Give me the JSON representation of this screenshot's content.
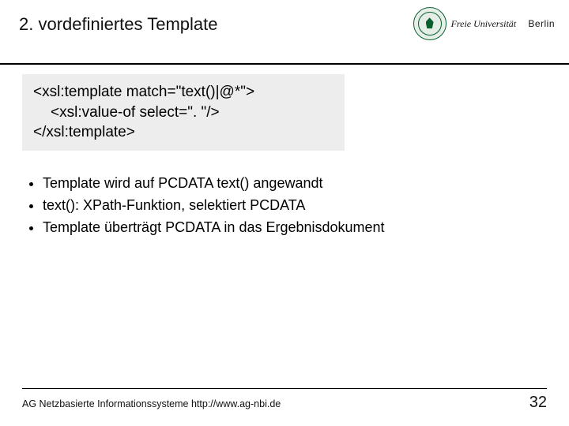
{
  "header": {
    "title": "2. vordefiniertes Template",
    "university": {
      "line1": "Freie Universität",
      "line2": "Berlin"
    }
  },
  "code": {
    "line1": "<xsl:template match=\"text()|@*\">",
    "line2": "<xsl:value-of select=\". \"/>",
    "line3": "</xsl:template>"
  },
  "bullets": [
    "Template wird auf PCDATA text() angewandt",
    "text(): XPath-Funktion, selektiert PCDATA",
    "Template überträgt PCDATA in das Ergebnisdokument"
  ],
  "footer": {
    "text": "AG Netzbasierte Informationssysteme http://www.ag-nbi.de",
    "page": "32"
  }
}
